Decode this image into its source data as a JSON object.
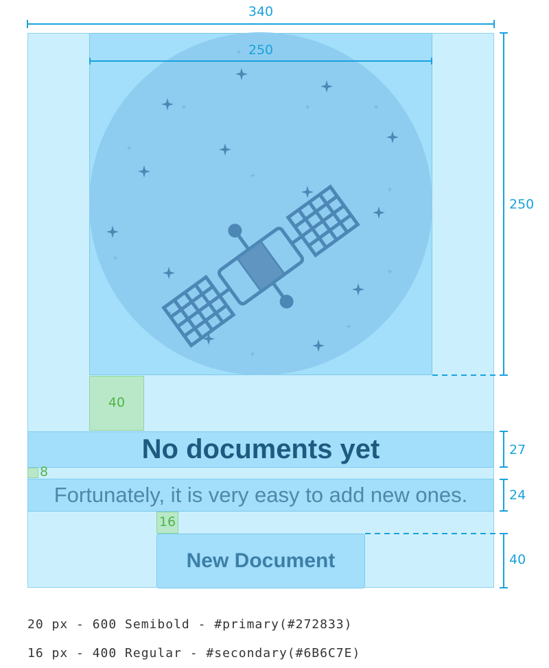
{
  "measurements": {
    "container_width": "340",
    "image_width": "250",
    "image_height": "250",
    "spacing_image_title": "40",
    "title_height": "27",
    "spacing_title_subtitle": "8",
    "subtitle_height": "24",
    "spacing_subtitle_button": "16",
    "button_height": "40"
  },
  "content": {
    "title": "No documents yet",
    "subtitle": "Fortunately, it is very easy to add new ones.",
    "button_label": "New Document"
  },
  "specs": {
    "title_style": "20 px - 600 Semibold - #primary(#272833)",
    "subtitle_style": "16 px - 400 Regular - #secondary(#6B6C7E)"
  },
  "colors": {
    "primary": "#272833",
    "secondary": "#6B6C7E",
    "dimension_line": "#1aa2dc",
    "spacing_marker": "#52b447"
  },
  "illustration": {
    "icon": "satellite-icon",
    "background": "stars-icon"
  }
}
